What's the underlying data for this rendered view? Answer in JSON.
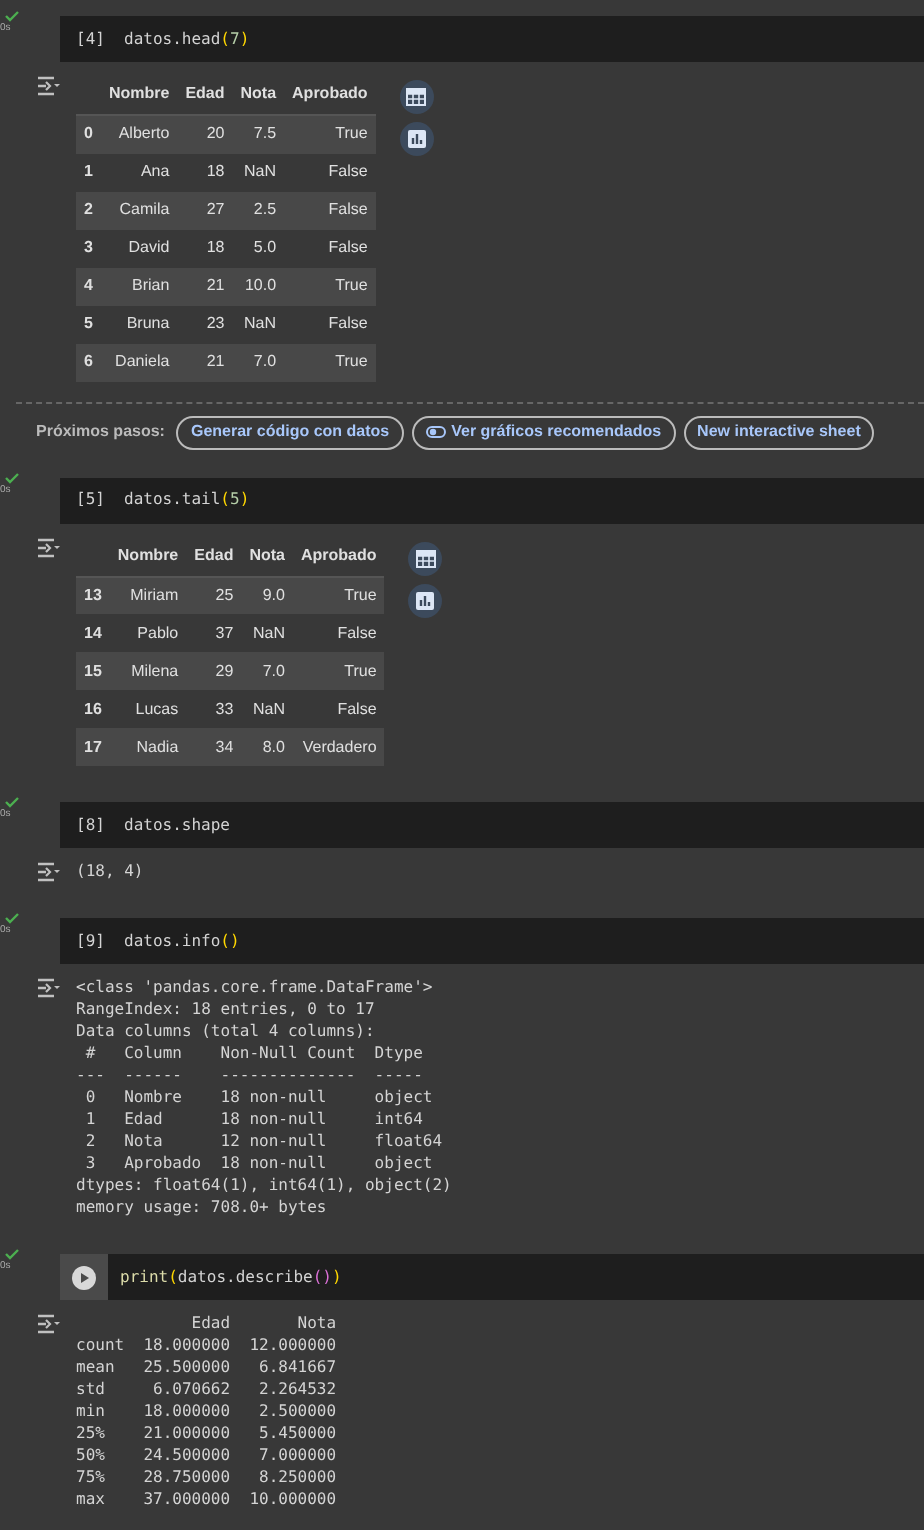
{
  "cells": [
    {
      "status": "0s",
      "prompt": "[4]",
      "code": [
        {
          "text": "datos.head",
          "kind": "plain"
        },
        {
          "text": "(",
          "kind": "bracket"
        },
        {
          "text": "7",
          "kind": "number"
        },
        {
          "text": ")",
          "kind": "bracket"
        }
      ],
      "output": {
        "kind": "dataframe",
        "columns": [
          "Nombre",
          "Edad",
          "Nota",
          "Aprobado"
        ],
        "rows": [
          {
            "index": "0",
            "values": [
              "Alberto",
              "20",
              "7.5",
              "True"
            ]
          },
          {
            "index": "1",
            "values": [
              "Ana",
              "18",
              "NaN",
              "False"
            ]
          },
          {
            "index": "2",
            "values": [
              "Camila",
              "27",
              "2.5",
              "False"
            ]
          },
          {
            "index": "3",
            "values": [
              "David",
              "18",
              "5.0",
              "False"
            ]
          },
          {
            "index": "4",
            "values": [
              "Brian",
              "21",
              "10.0",
              "True"
            ]
          },
          {
            "index": "5",
            "values": [
              "Bruna",
              "23",
              "NaN",
              "False"
            ]
          },
          {
            "index": "6",
            "values": [
              "Daniela",
              "21",
              "7.0",
              "True"
            ]
          }
        ]
      },
      "next_steps": {
        "label": "Próximos pasos:",
        "buttons": [
          {
            "label": "Generar código con datos",
            "kind": "plain"
          },
          {
            "label": "Ver gráficos recomendados",
            "kind": "toggle"
          },
          {
            "label": "New interactive sheet",
            "kind": "plain"
          }
        ]
      }
    },
    {
      "status": "0s",
      "prompt": "[5]",
      "code": [
        {
          "text": "datos.tail",
          "kind": "plain"
        },
        {
          "text": "(",
          "kind": "bracket"
        },
        {
          "text": "5",
          "kind": "number"
        },
        {
          "text": ")",
          "kind": "bracket"
        }
      ],
      "output": {
        "kind": "dataframe",
        "columns": [
          "Nombre",
          "Edad",
          "Nota",
          "Aprobado"
        ],
        "rows": [
          {
            "index": "13",
            "values": [
              "Miriam",
              "25",
              "9.0",
              "True"
            ]
          },
          {
            "index": "14",
            "values": [
              "Pablo",
              "37",
              "NaN",
              "False"
            ]
          },
          {
            "index": "15",
            "values": [
              "Milena",
              "29",
              "7.0",
              "True"
            ]
          },
          {
            "index": "16",
            "values": [
              "Lucas",
              "33",
              "NaN",
              "False"
            ]
          },
          {
            "index": "17",
            "values": [
              "Nadia",
              "34",
              "8.0",
              "Verdadero"
            ]
          }
        ]
      }
    },
    {
      "status": "0s",
      "prompt": "[8]",
      "code": [
        {
          "text": "datos.shape",
          "kind": "plain"
        }
      ],
      "output": {
        "kind": "text",
        "lines": [
          "(18, 4)"
        ]
      }
    },
    {
      "status": "0s",
      "prompt": "[9]",
      "code": [
        {
          "text": "datos.info",
          "kind": "plain"
        },
        {
          "text": "()",
          "kind": "bracket"
        }
      ],
      "output": {
        "kind": "text",
        "lines": [
          "<class 'pandas.core.frame.DataFrame'>",
          "RangeIndex: 18 entries, 0 to 17",
          "Data columns (total 4 columns):",
          " #   Column    Non-Null Count  Dtype  ",
          "---  ------    --------------  -----  ",
          " 0   Nombre    18 non-null     object ",
          " 1   Edad      18 non-null     int64  ",
          " 2   Nota      12 non-null     float64",
          " 3   Aprobado  18 non-null     object ",
          "dtypes: float64(1), int64(1), object(2)",
          "memory usage: 708.0+ bytes"
        ]
      }
    },
    {
      "status": "0s",
      "code": [
        {
          "text": "print",
          "kind": "function"
        },
        {
          "text": "(",
          "kind": "bracket"
        },
        {
          "text": "datos.describe",
          "kind": "plain"
        },
        {
          "text": "()",
          "kind": "bracket2"
        },
        {
          "text": ")",
          "kind": "bracket"
        }
      ],
      "output": {
        "kind": "text",
        "lines": [
          "            Edad       Nota",
          "count  18.000000  12.000000",
          "mean   25.500000   6.841667",
          "std     6.070662   2.264532",
          "min    18.000000   2.500000",
          "25%    21.000000   5.450000",
          "50%    24.500000   7.000000",
          "75%    28.750000   8.250000",
          "max    37.000000  10.000000"
        ]
      }
    }
  ]
}
